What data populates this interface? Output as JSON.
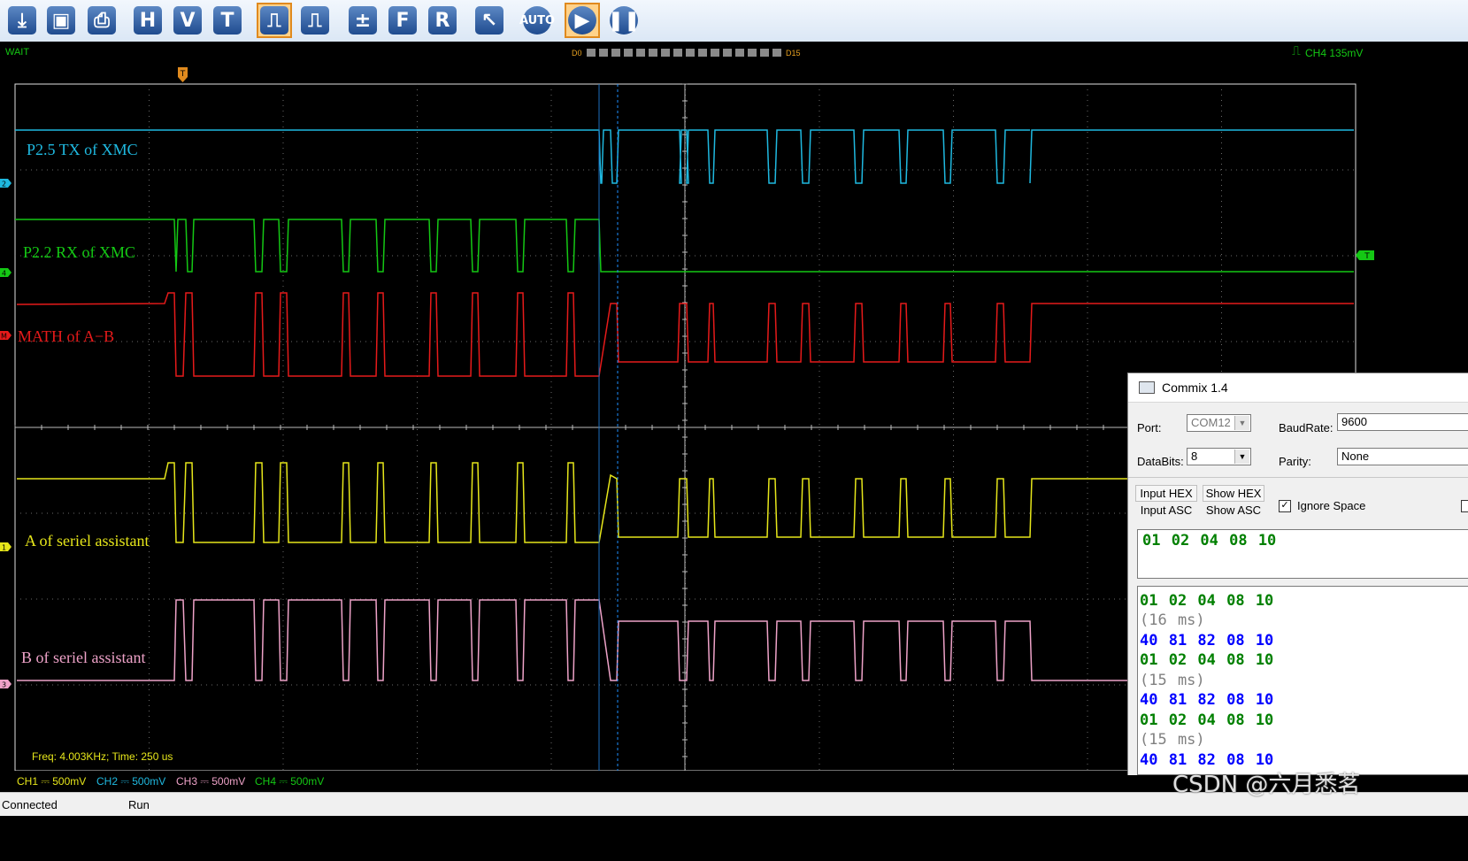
{
  "toolbar": {
    "buttons": [
      {
        "name": "export-icon",
        "glyph": "⤓",
        "label": ""
      },
      {
        "name": "save-icon",
        "glyph": "▣",
        "label": ""
      },
      {
        "name": "print-icon",
        "glyph": "⎙",
        "label": ""
      },
      {
        "name": "h-button",
        "glyph": "H",
        "label": "H"
      },
      {
        "name": "v-button",
        "glyph": "V",
        "label": "V"
      },
      {
        "name": "t-button",
        "glyph": "T",
        "label": "T"
      },
      {
        "name": "pulse-icon",
        "glyph": "⎍",
        "label": ""
      },
      {
        "name": "pulse-measure-icon",
        "glyph": "⎍",
        "label": ""
      },
      {
        "name": "math-icon",
        "glyph": "±",
        "label": ""
      },
      {
        "name": "f-button",
        "glyph": "F",
        "label": "F"
      },
      {
        "name": "r-button",
        "glyph": "R",
        "label": "R"
      },
      {
        "name": "cursor-icon",
        "glyph": "↖",
        "label": ""
      },
      {
        "name": "auto-button",
        "glyph": "AUTO",
        "label": "AUTO"
      },
      {
        "name": "run-icon",
        "glyph": "▶",
        "label": ""
      },
      {
        "name": "pause-icon",
        "glyph": "❚❚",
        "label": ""
      }
    ]
  },
  "status": {
    "mode": "WAIT",
    "digital_start": "D0",
    "digital_end": "D15",
    "trigger_info": "CH4 135mV",
    "trigger_marker": "T"
  },
  "channels": [
    {
      "marker": "2",
      "label": "P2.5 TX of XMC",
      "color": "#1fb9e0"
    },
    {
      "marker": "4",
      "label": "P2.2 RX of XMC",
      "color": "#14c814"
    },
    {
      "marker": "M",
      "label": "MATH of A−B",
      "color": "#e61a1a"
    },
    {
      "marker": "1",
      "label": "A of seriel assistant",
      "color": "#e6e61a"
    },
    {
      "marker": "3",
      "label": "B of seriel assistant",
      "color": "#eea2c8"
    }
  ],
  "right_marker": "T",
  "measurement": "Freq: 4.003KHz; Time: 250 us",
  "scales": [
    {
      "text": "CH1 ⎓ 500mV",
      "color": "#e6e61a"
    },
    {
      "text": "CH2 ⎓ 500mV",
      "color": "#1fb9e0"
    },
    {
      "text": "CH3 ⎓ 500mV",
      "color": "#eea2c8"
    },
    {
      "text": "CH4 ⎓ 500mV",
      "color": "#14c814"
    }
  ],
  "app_status": {
    "connection": "Connected",
    "state": "Run"
  },
  "commix": {
    "title": "Commix 1.4",
    "port_label": "Port:",
    "port_value": "COM12",
    "baud_label": "BaudRate:",
    "baud_value": "9600",
    "databits_label": "DataBits:",
    "databits_value": "8",
    "parity_label": "Parity:",
    "parity_value": "None",
    "input_hex": "Input HEX",
    "input_asc": "Input ASC",
    "show_hex": "Show HEX",
    "show_asc": "Show ASC",
    "ignore_space": "Ignore Space",
    "ignore_space_checked": true,
    "send_text": "01 02 04 08 10",
    "received": [
      {
        "text": "01 02 04 08 10",
        "color": "#008000"
      },
      {
        "text": "(16 ms)",
        "color": "#808080"
      },
      {
        "text": "40 81 82 08 10",
        "color": "#0000ff"
      },
      {
        "text": "01 02 04 08 10",
        "color": "#008000"
      },
      {
        "text": "(15 ms)",
        "color": "#808080"
      },
      {
        "text": "40 81 82 08 10",
        "color": "#0000ff"
      },
      {
        "text": "01 02 04 08 10",
        "color": "#008000"
      },
      {
        "text": "(15 ms)",
        "color": "#808080"
      },
      {
        "text": "40 81 82 08 10",
        "color": "#0000ff"
      }
    ]
  },
  "watermark": "CSDN @六月悉茗"
}
